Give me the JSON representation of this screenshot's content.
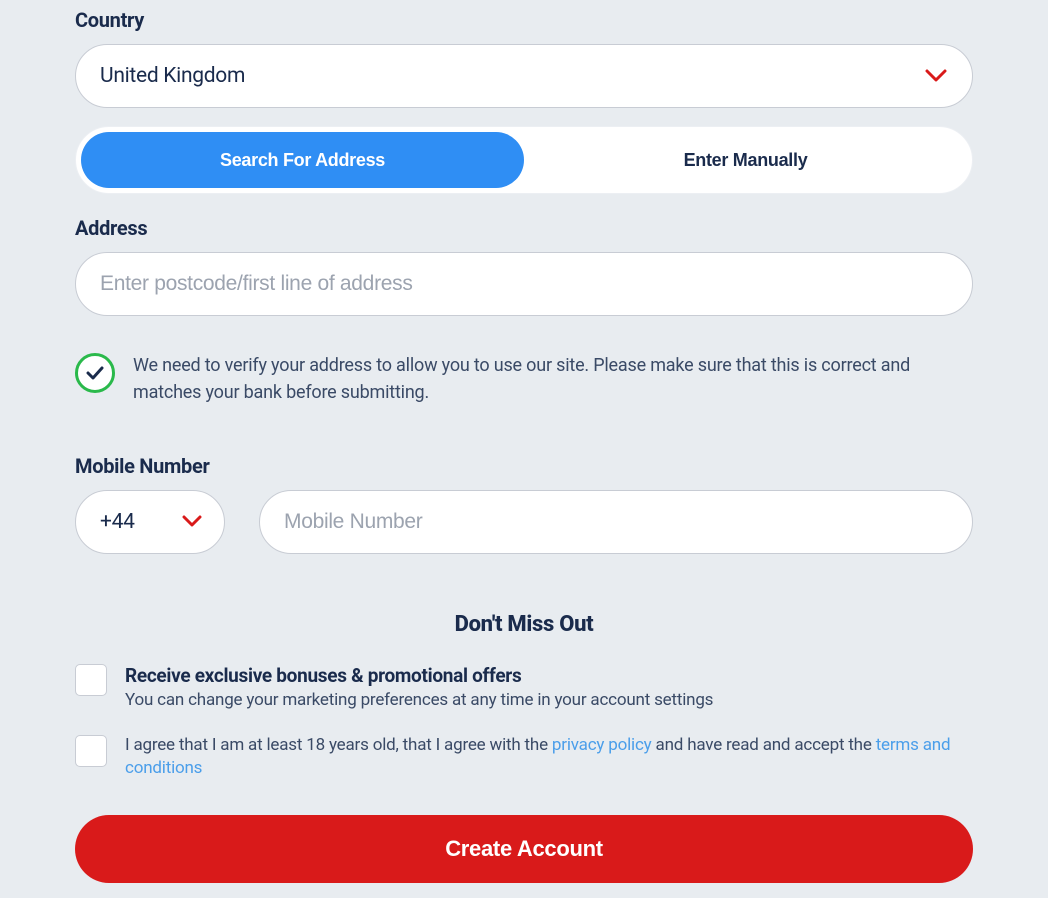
{
  "country": {
    "label": "Country",
    "value": "United Kingdom"
  },
  "address_mode": {
    "search": "Search For Address",
    "manual": "Enter Manually"
  },
  "address": {
    "label": "Address",
    "placeholder": "Enter postcode/first line of address"
  },
  "verify_notice": "We need to verify your address to allow you to use our site. Please make sure that this is correct and matches your bank before submitting.",
  "mobile": {
    "label": "Mobile Number",
    "code": "+44",
    "placeholder": "Mobile Number"
  },
  "marketing_heading": "Don't Miss Out",
  "marketing": {
    "title": "Receive exclusive bonuses & promotional offers",
    "subtitle": "You can change your marketing preferences at any time in your account settings"
  },
  "agreement": {
    "prefix": "I agree that I am at least 18 years old, that I agree with the ",
    "privacy_link": "privacy policy",
    "middle": " and have read and accept the ",
    "terms_link": "terms and conditions"
  },
  "submit": "Create Account",
  "colors": {
    "accent_blue": "#2f8ef4",
    "accent_red": "#d91a1a",
    "success_green": "#2ab94b",
    "link_blue": "#4a9eea"
  }
}
